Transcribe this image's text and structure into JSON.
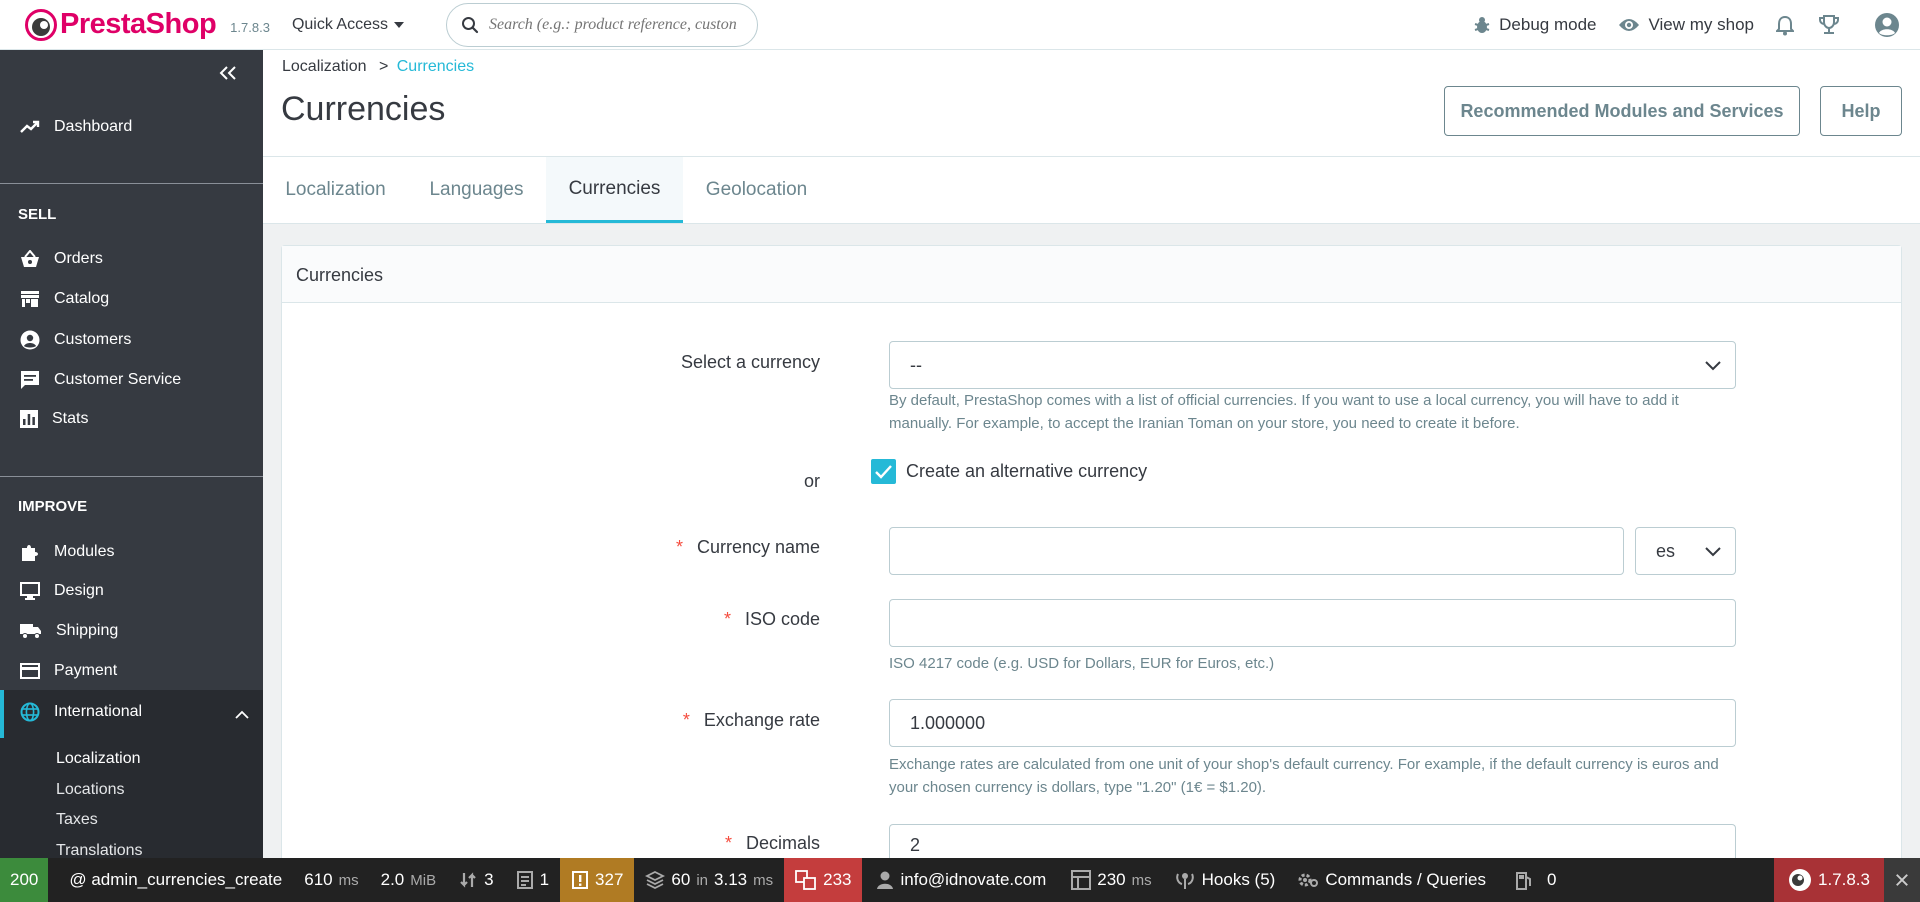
{
  "header": {
    "logo_brand": "PrestaShop",
    "version": "1.7.8.3",
    "quick_access": "Quick Access",
    "search_placeholder": "Search (e.g.: product reference, custon",
    "debug_mode": "Debug mode",
    "view_shop": "View my shop"
  },
  "sidebar": {
    "dashboard": "Dashboard",
    "sections": {
      "sell": "SELL",
      "improve": "IMPROVE"
    },
    "sell_items": [
      "Orders",
      "Catalog",
      "Customers",
      "Customer Service",
      "Stats"
    ],
    "improve_items": [
      "Modules",
      "Design",
      "Shipping",
      "Payment",
      "International"
    ],
    "international_sub": [
      "Localization",
      "Locations",
      "Taxes",
      "Translations"
    ]
  },
  "page": {
    "breadcrumb_parent": "Localization",
    "breadcrumb_sep": ">",
    "breadcrumb_current": "Currencies",
    "title": "Currencies",
    "btn_recommended": "Recommended Modules and Services",
    "btn_help": "Help"
  },
  "tabs": [
    "Localization",
    "Languages",
    "Currencies",
    "Geolocation"
  ],
  "form": {
    "card_title": "Currencies",
    "select_currency_label": "Select a currency",
    "select_currency_value": "--",
    "select_currency_help": "By default, PrestaShop comes with a list of official currencies. If you want to use a local currency, you will have to add it manually. For example, to accept the Iranian Toman on your store, you need to create it before.",
    "or_label": "or",
    "alt_currency_label": "Create an alternative currency",
    "currency_name_label": "Currency name",
    "currency_name_value": "",
    "lang_value": "es",
    "iso_label": "ISO code",
    "iso_value": "",
    "iso_help": "ISO 4217 code (e.g. USD for Dollars, EUR for Euros, etc.)",
    "exchange_label": "Exchange rate",
    "exchange_value": "1.000000",
    "exchange_help": "Exchange rates are calculated from one unit of your shop's default currency. For example, if the default currency is euros and your chosen currency is dollars, type \"1.20\" (1€ = $1.20).",
    "decimals_label": "Decimals",
    "decimals_value": "2",
    "required_mark": "*"
  },
  "debugbar": {
    "status": "200",
    "route": "@ admin_currencies_create",
    "time": "610",
    "time_unit": "ms",
    "memory": "2.0",
    "memory_unit": "MiB",
    "requests": "3",
    "forms": "1",
    "logs": "327",
    "layers": "60",
    "layers_in": "in",
    "layers_time": "3.13",
    "layers_unit": "ms",
    "translations": "233",
    "user": "info@idnovate.com",
    "db_time": "230",
    "db_unit": "ms",
    "hooks": "Hooks (5)",
    "commands": "Commands / Queries",
    "cache": "0",
    "version": "1.7.8.3",
    "colors": {
      "status_bg": "#3c8b3c",
      "logs_bg": "#b07b23",
      "translations_bg": "#c43d3d",
      "version_bg": "#a83236"
    }
  },
  "colors": {
    "accent": "#25b9d7",
    "brand": "#df0067",
    "sidebar_bg": "#363a41",
    "required": "#f54c3e"
  }
}
